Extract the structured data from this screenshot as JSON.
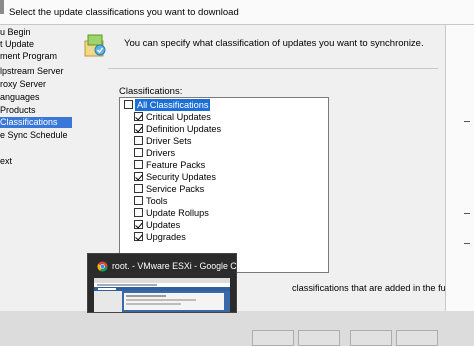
{
  "header": {
    "title": "Select the update classifications you want to download"
  },
  "nav": {
    "items": [
      {
        "label": "u Begin"
      },
      {
        "label": "t Update"
      },
      {
        "label": "ment Program"
      },
      {
        "label": "lpstream Server"
      },
      {
        "label": "roxy Server"
      },
      {
        "label": "anguages"
      },
      {
        "label": "Products"
      },
      {
        "label": "Classifications",
        "selected": true
      },
      {
        "label": "e Sync Schedule"
      },
      {
        "label": ""
      },
      {
        "label": "ext"
      }
    ]
  },
  "main": {
    "description": "You can specify what classification of updates you want to synchronize.",
    "classifications_label": "Classifications:",
    "classifications": [
      {
        "label": "All Classifications",
        "checked": false,
        "all": true
      },
      {
        "label": "Critical Updates",
        "checked": true
      },
      {
        "label": "Definition Updates",
        "checked": true
      },
      {
        "label": "Driver Sets",
        "checked": false
      },
      {
        "label": "Drivers",
        "checked": false
      },
      {
        "label": "Feature Packs",
        "checked": false
      },
      {
        "label": "Security Updates",
        "checked": true
      },
      {
        "label": "Service Packs",
        "checked": false
      },
      {
        "label": "Tools",
        "checked": false
      },
      {
        "label": "Update Rollups",
        "checked": false
      },
      {
        "label": "Updates",
        "checked": true
      },
      {
        "label": "Upgrades",
        "checked": true
      }
    ],
    "future_text": "classifications that are added in the future."
  },
  "taskbar_preview": {
    "title": "root. - VMware ESXi - Google C..."
  },
  "colors": {
    "selection": "#3a78d8",
    "highlight": "#1c6fd6",
    "popup_bg": "#2b2b2b"
  }
}
